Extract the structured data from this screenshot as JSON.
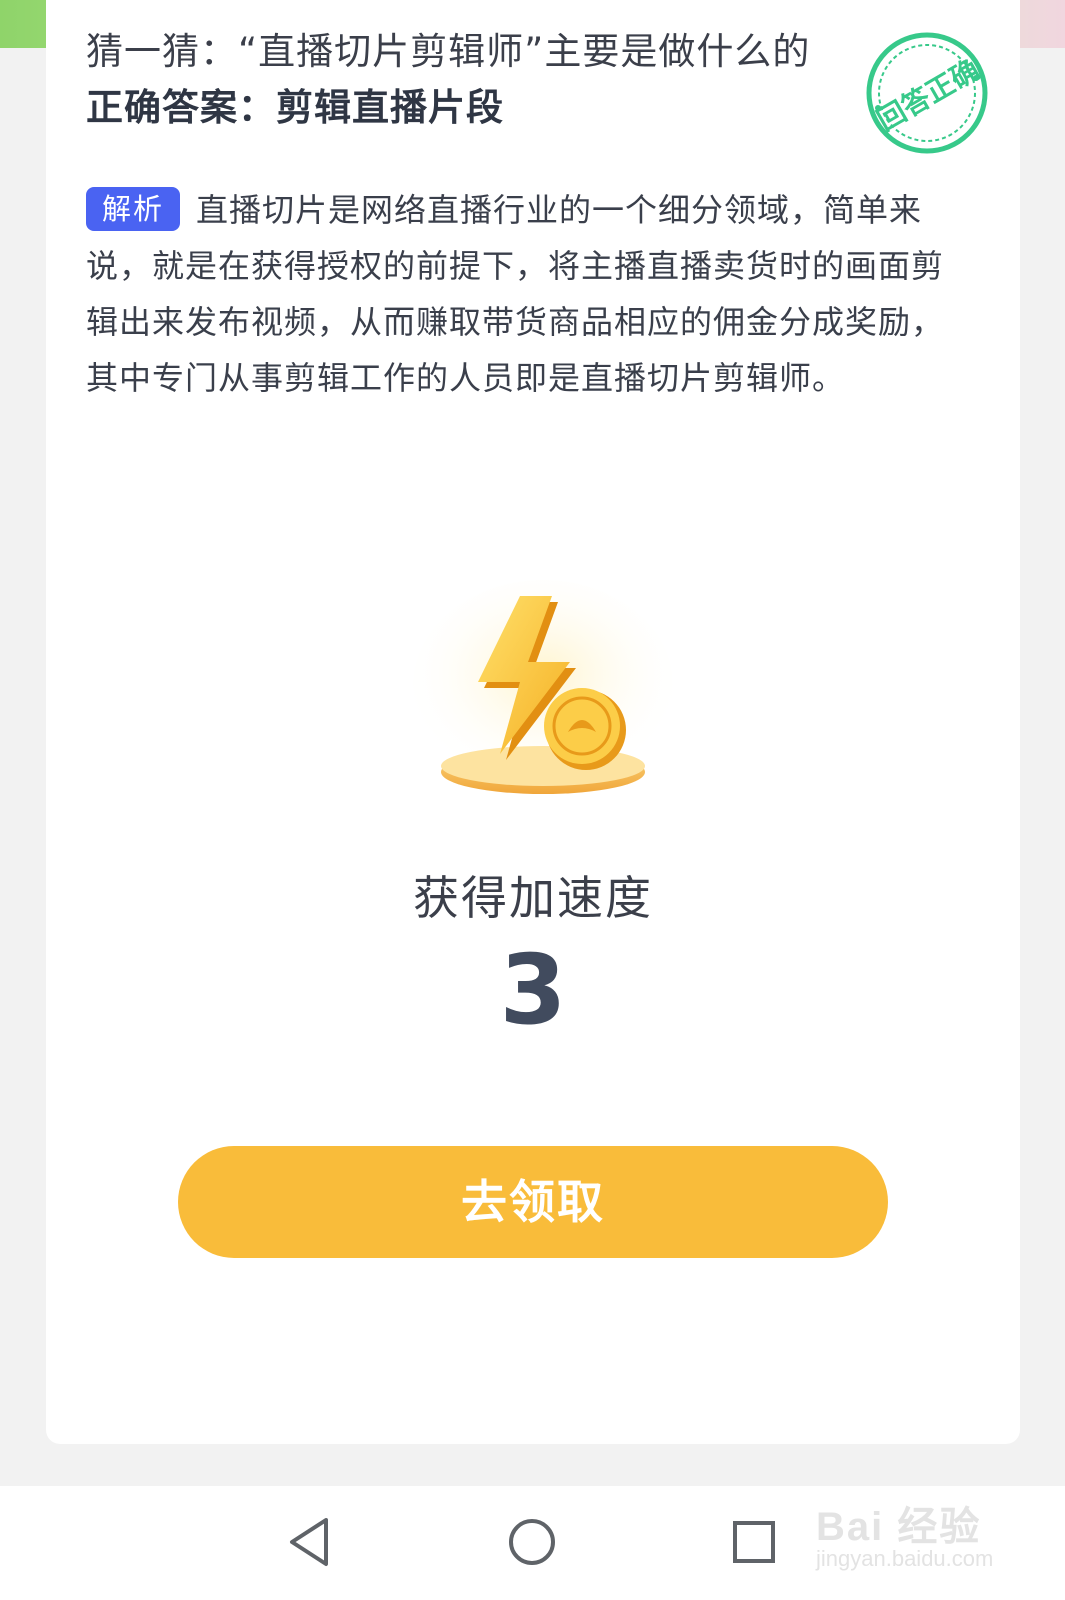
{
  "question": {
    "prompt": "猜一猜：“直播切片剪辑师”主要是做什么的",
    "answer": "正确答案：剪辑直播片段"
  },
  "stamp": {
    "text": "回答正确",
    "color": "#37c98a"
  },
  "analysis": {
    "tag": "解析",
    "text": "直播切片是网络直播行业的一个细分领域，简单来说，就是在获得授权的前提下，将主播直播卖货时的画面剪辑出来发布视频，从而赚取带货商品相应的佣金分成奖励，其中专门从事剪辑工作的人员即是直播切片剪辑师。"
  },
  "reward": {
    "icon": "lightning-coin-icon",
    "title": "获得加速度",
    "count": "3"
  },
  "claim_button": {
    "label": "去领取",
    "color": "#f9bc3a"
  },
  "nav": {
    "back_icon": "back-triangle-icon",
    "home_icon": "home-circle-icon",
    "recents_icon": "recents-square-icon"
  },
  "watermark": {
    "brand": "Bai 经验",
    "url": "jingyan.baidu.com"
  }
}
